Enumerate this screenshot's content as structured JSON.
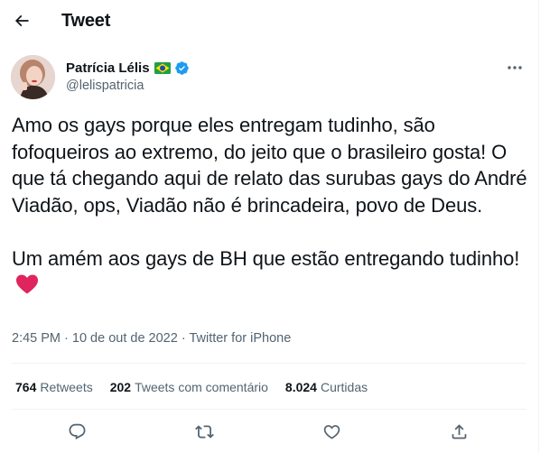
{
  "header": {
    "title": "Tweet",
    "back_icon": "arrow-left-icon"
  },
  "author": {
    "name": "Patrícia Lélis",
    "handle": "@lelispatricia",
    "flag_icon": "brazil-flag-icon",
    "verified_icon": "verified-badge-icon",
    "verified_color": "#1d9bf0"
  },
  "tweet": {
    "text": "Amo os gays porque eles entregam tudinho, são fofoqueiros ao extremo, do jeito que o brasileiro gosta! O que tá chegando aqui de relato das surubas gays do André Viadão, ops, Viadão não é brincadeira, povo de Deus.\n\nUm amém aos gays de BH que estão entregando tudinho!",
    "emoji": "red-heart-icon"
  },
  "meta": {
    "time": "2:45 PM",
    "separator": " · ",
    "date": "10 de out de 2022",
    "source": "Twitter for iPhone"
  },
  "stats": {
    "retweets_count": "764",
    "retweets_label": "Retweets",
    "quotes_count": "202",
    "quotes_label": "Tweets com comentário",
    "likes_count": "8.024",
    "likes_label": "Curtidas"
  },
  "actions": [
    "reply-icon",
    "retweet-icon",
    "like-icon",
    "share-icon"
  ],
  "colors": {
    "text": "#0f1419",
    "secondary": "#536471",
    "border": "#eff3f4",
    "accent": "#1d9bf0",
    "heart": "#e0245e"
  }
}
